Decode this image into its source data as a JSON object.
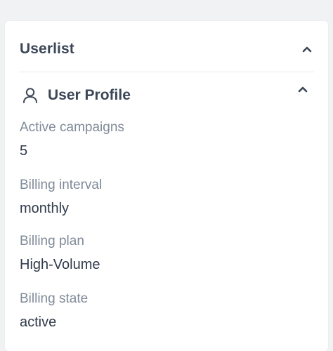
{
  "panel": {
    "title": "Userlist",
    "collapse_icon": "chevron-up-icon"
  },
  "section": {
    "icon": "user-icon",
    "title": "User Profile",
    "collapse_icon": "chevron-up-icon"
  },
  "fields": [
    {
      "label": "Active campaigns",
      "value": "5"
    },
    {
      "label": "Billing interval",
      "value": "monthly"
    },
    {
      "label": "Billing plan",
      "value": "High-Volume"
    },
    {
      "label": "Billing state",
      "value": "active"
    }
  ],
  "colors": {
    "background": "#f1f2f4",
    "card": "#ffffff",
    "heading": "#3b4656",
    "label": "#7f8a99",
    "value": "#2f3a4a"
  }
}
